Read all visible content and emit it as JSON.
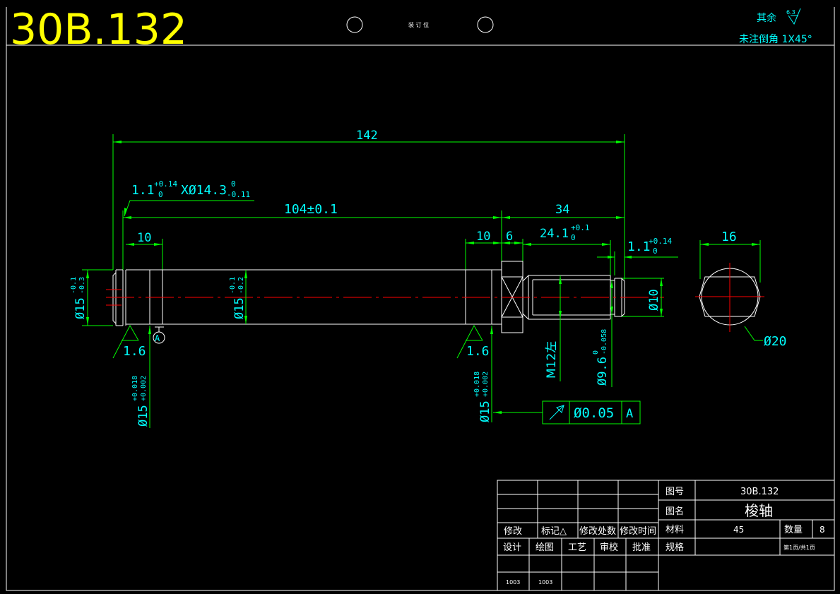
{
  "drawing_number_large": "30B.132",
  "binding_label": "装 订 位",
  "roughness_note": {
    "label": "其余",
    "value": "6.3"
  },
  "chamfer_note": "未注倒角 1X45°",
  "dimensions": {
    "overall_length": "142",
    "groove_spec_a": "1.1",
    "groove_spec_a_tol_upper": "+0.14",
    "groove_spec_a_tol_lower": "0",
    "groove_spec_x": "XØ14.3",
    "groove_spec_b_tol_upper": "0",
    "groove_spec_b_tol_lower": "-0.11",
    "main_length": "104±0.1",
    "right_length": "34",
    "left_seg": "10",
    "right_seg": "10",
    "hex_width": "6",
    "thread_length": "24.1",
    "thread_length_tol_upper": "+0.1",
    "thread_length_tol_lower": "0",
    "right_groove": "1.1",
    "right_groove_tol_upper": "+0.14",
    "right_groove_tol_lower": "0",
    "end_view_width": "16",
    "left_dia": "Ø15",
    "left_dia_tol_upper": "-0.1",
    "left_dia_tol_lower": "-0.3",
    "mid_dia": "Ø15",
    "mid_dia_tol_upper": "-0.1",
    "mid_dia_tol_lower": "-0.2",
    "right_end_dia": "Ø10",
    "end_view_dia": "Ø20",
    "bearing_dia_left": "Ø15",
    "bearing_dia_left_tol_upper": "+0.018",
    "bearing_dia_left_tol_lower": "+0.002",
    "bearing_dia_right": "Ø15",
    "bearing_dia_right_tol_upper": "+0.018",
    "bearing_dia_right_tol_lower": "+0.002",
    "thread": "M12左",
    "undercut_dia": "Ø9.6",
    "undercut_tol_upper": "0",
    "undercut_tol_lower": "-0.058",
    "roughness_left": "1.6",
    "roughness_right": "1.6",
    "datum": "A"
  },
  "tolerance_frame": {
    "tolerance": "Ø0.05",
    "datum": "A"
  },
  "title_block": {
    "drawing_no_label": "图号",
    "drawing_no": "30B.132",
    "name_label": "图名",
    "name": "梭轴",
    "material_label": "材料",
    "material": "45",
    "qty_label": "数量",
    "qty": "8",
    "spec_label": "规格",
    "page": "第1页/共1页",
    "rev_headers": [
      "修改",
      "标记△",
      "修改处数",
      "修改时间"
    ],
    "sign_headers": [
      "设计",
      "绘图",
      "工艺",
      "审校",
      "批准"
    ],
    "sign_values": [
      "1003",
      "1003"
    ]
  },
  "colors": {
    "background": "#000000",
    "outline": "#ffffff",
    "dimension": "#00ff00",
    "text": "#00ffff",
    "centerline": "#ff0000",
    "title": "#ffff00"
  }
}
